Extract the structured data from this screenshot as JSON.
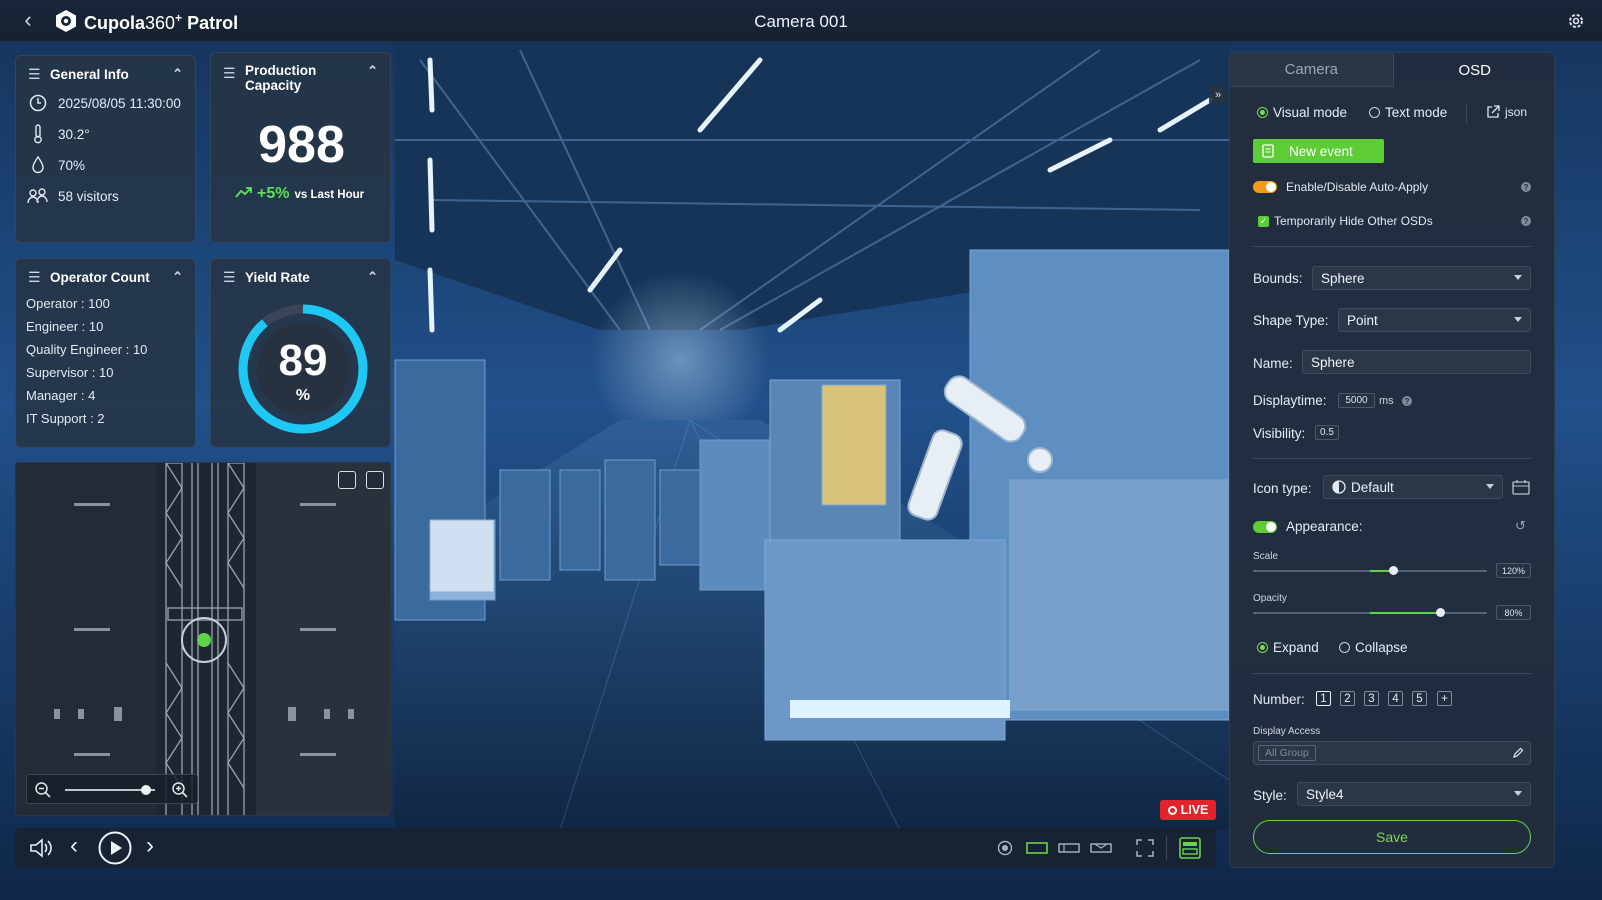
{
  "app": {
    "brand_main": "Cupola",
    "brand_num": "360",
    "brand_sup": "+",
    "brand_suffix": " Patrol",
    "camera_title": "Camera 001"
  },
  "general_info": {
    "title": "General Info",
    "datetime": "2025/08/05 11:30:00",
    "temperature": "30.2°",
    "humidity": "70%",
    "visitors": "58 visitors"
  },
  "production": {
    "title_line1": "Production",
    "title_line2": "Capacity",
    "value": "988",
    "change": "+5%",
    "change_note": "vs Last Hour"
  },
  "operator_count": {
    "title": "Operator Count",
    "rows": [
      "Operator : 100",
      "Engineer : 10",
      "Quality Engineer : 10",
      "Supervisor : 10",
      "Manager : 4",
      "IT Support : 2"
    ]
  },
  "yield_rate": {
    "title": "Yield Rate",
    "value": "89",
    "unit": "%",
    "fraction": 0.89
  },
  "minimap": {
    "zoom_level": 0.9
  },
  "video": {
    "live_label": "LIVE",
    "collapse_icon": "»"
  },
  "panel": {
    "tab_camera": "Camera",
    "tab_osd": "OSD",
    "visual_mode": "Visual mode",
    "text_mode": "Text mode",
    "json_label": "json",
    "new_event": "New event",
    "auto_apply": "Enable/Disable Auto-Apply",
    "hide_osds": "Temporarily Hide Other OSDs",
    "bounds_label": "Bounds:",
    "bounds_value": "Sphere",
    "shape_label": "Shape Type:",
    "shape_value": "Point",
    "name_label": "Name:",
    "name_value": "Sphere",
    "displaytime_label": "Displaytime:",
    "displaytime_value": "5000",
    "displaytime_unit": "ms",
    "visibility_label": "Visibility:",
    "visibility_value": "0.5",
    "icon_type_label": "Icon type:",
    "icon_type_value": "Default",
    "appearance_label": "Appearance:",
    "scale_label": "Scale",
    "scale_value": "120%",
    "scale_fraction": 0.6,
    "opacity_label": "Opacity",
    "opacity_value": "80%",
    "opacity_fraction": 0.8,
    "expand_label": "Expand",
    "collapse_label": "Collapse",
    "number_label": "Number:",
    "numbers": [
      "1",
      "2",
      "3",
      "4",
      "5",
      "+"
    ],
    "display_access_label": "Display Access",
    "display_access_tag": "All Group",
    "style_label": "Style:",
    "style_value": "Style4",
    "save_label": "Save"
  },
  "colors": {
    "accent_green": "#5dcc35",
    "toggle_orange": "#f29a1a",
    "live_red": "#e3232c",
    "yield_cyan": "#1ec8f5"
  }
}
